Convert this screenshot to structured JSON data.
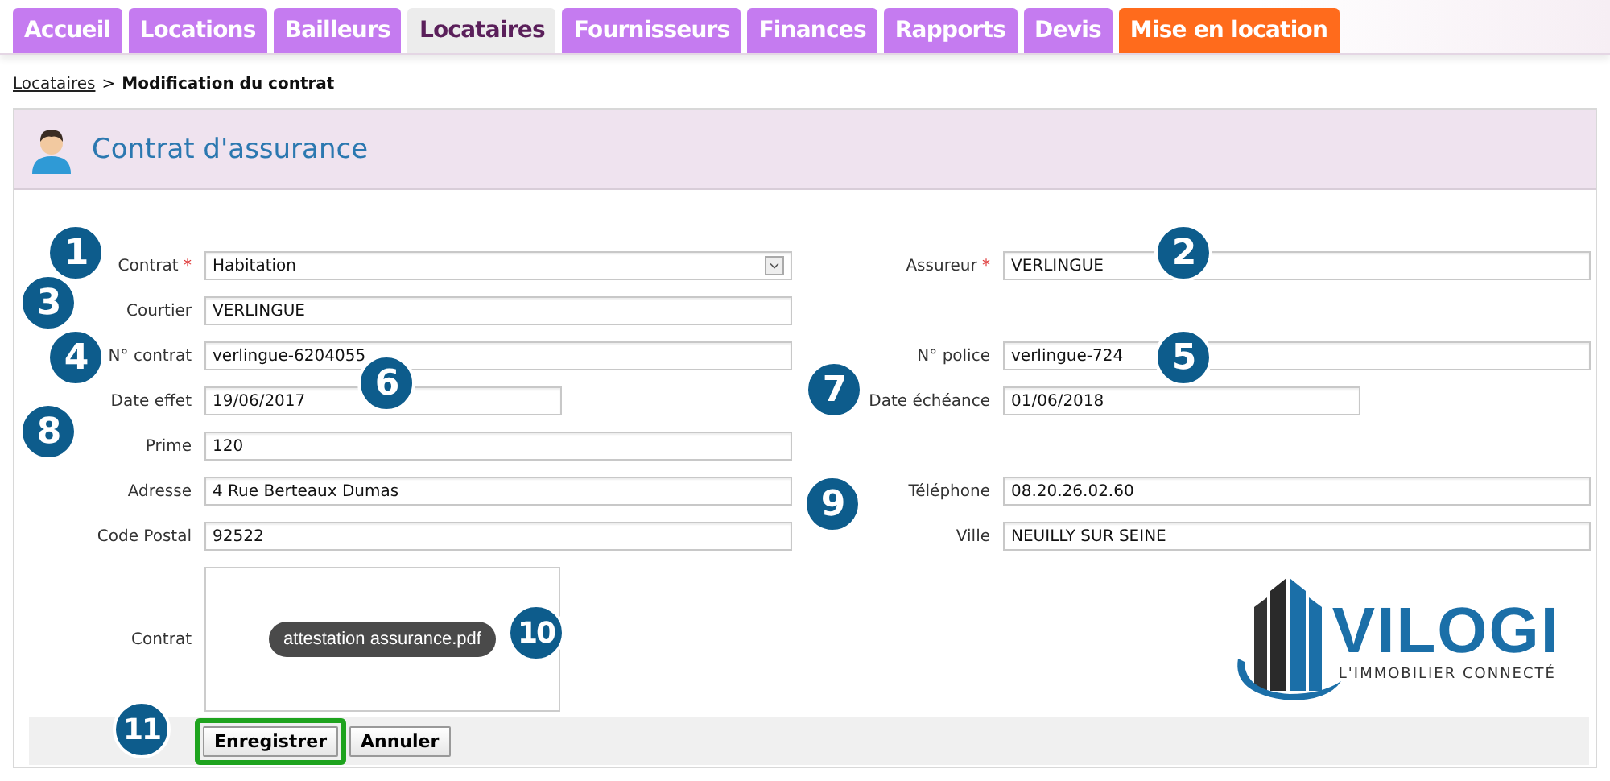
{
  "tabs": [
    {
      "label": "Accueil",
      "selected": false,
      "color": "#c57bf0"
    },
    {
      "label": "Locations",
      "selected": false,
      "color": "#c57bf0"
    },
    {
      "label": "Bailleurs",
      "selected": false,
      "color": "#c57bf0"
    },
    {
      "label": "Locataires",
      "selected": true,
      "color": "#ececec"
    },
    {
      "label": "Fournisseurs",
      "selected": false,
      "color": "#c57bf0"
    },
    {
      "label": "Finances",
      "selected": false,
      "color": "#c57bf0"
    },
    {
      "label": "Rapports",
      "selected": false,
      "color": "#c57bf0"
    },
    {
      "label": "Devis",
      "selected": false,
      "color": "#c57bf0"
    },
    {
      "label": "Mise en location",
      "selected": false,
      "color": "#ff6b1c"
    }
  ],
  "breadcrumb": {
    "link": "Locataires",
    "separator": ">",
    "current": "Modification du contrat"
  },
  "panel": {
    "title": "Contrat d'assurance"
  },
  "rows": [
    {
      "left": {
        "label": "Contrat",
        "required_mark": "*",
        "kind": "select",
        "value": "Habitation"
      },
      "right": {
        "label": "Assureur",
        "required_mark": "*",
        "kind": "text",
        "value": "VERLINGUE"
      }
    },
    {
      "left": {
        "label": "Courtier",
        "kind": "text",
        "value": "VERLINGUE"
      }
    },
    {
      "left": {
        "label": "N° contrat",
        "kind": "text",
        "value": "verlingue-6204055"
      },
      "right": {
        "label": "N° police",
        "kind": "text",
        "value": "verlingue-724"
      }
    },
    {
      "left": {
        "label": "Date effet",
        "kind": "date",
        "value": "19/06/2017"
      },
      "right": {
        "label": "Date échéance",
        "kind": "date",
        "value": "01/06/2018"
      }
    },
    {
      "left": {
        "label": "Prime",
        "kind": "text",
        "value": "120"
      }
    },
    {
      "left": {
        "label": "Adresse",
        "kind": "text",
        "value": "4 Rue Berteaux Dumas"
      },
      "right": {
        "label": "Téléphone",
        "kind": "text",
        "value": "08.20.26.02.60"
      }
    },
    {
      "left": {
        "label": "Code Postal",
        "kind": "text",
        "value": "92522"
      },
      "right": {
        "label": "Ville",
        "kind": "text",
        "value": "NEUILLY SUR SEINE"
      }
    }
  ],
  "attachment": {
    "label": "Contrat",
    "file": "attestation assurance.pdf"
  },
  "logo": {
    "name": "VILOGI",
    "tagline": "L'IMMOBILIER CONNECTÉ"
  },
  "buttons": [
    {
      "label": "Enregistrer",
      "highlighted": true
    },
    {
      "label": "Annuler"
    }
  ],
  "callouts": [
    "1",
    "2",
    "3",
    "4",
    "5",
    "6",
    "7",
    "8",
    "9",
    "10",
    "11"
  ]
}
